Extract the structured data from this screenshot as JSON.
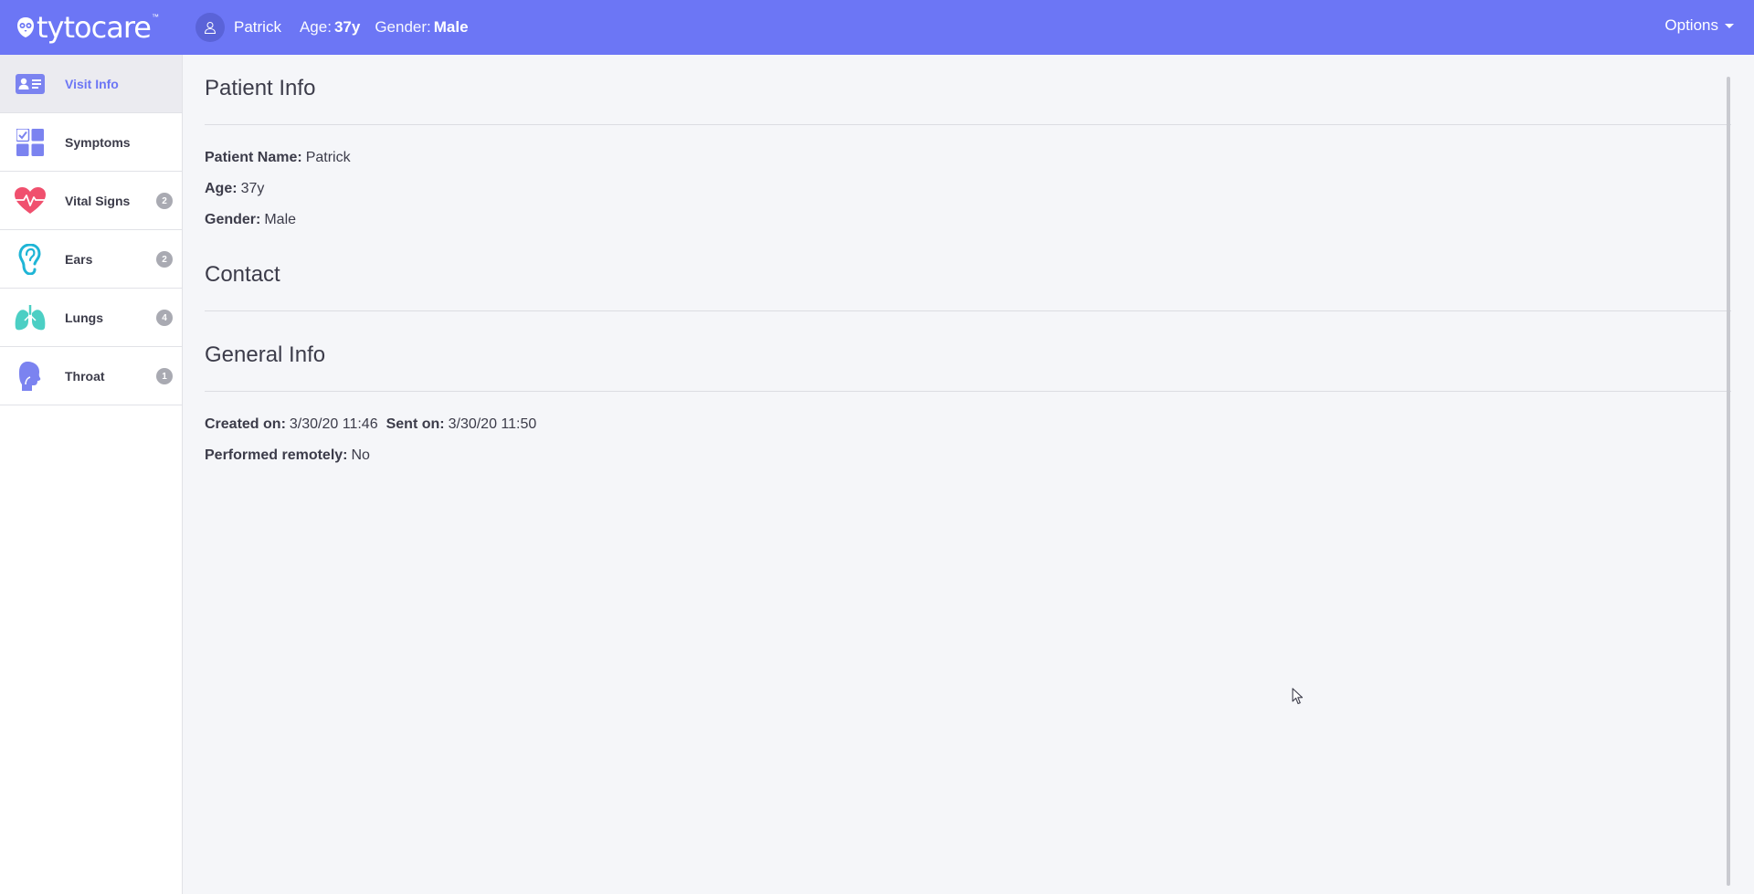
{
  "brand": {
    "logo_text": "tytocare",
    "trademark": "™"
  },
  "header": {
    "patient_name": "Patrick",
    "age_label": "Age:",
    "age_value": "37y",
    "gender_label": "Gender:",
    "gender_value": "Male",
    "options_label": "Options"
  },
  "sidebar": {
    "items": [
      {
        "label": "Visit Info",
        "icon": "id-card-icon",
        "badge": "",
        "active": true
      },
      {
        "label": "Symptoms",
        "icon": "symptoms-grid-icon",
        "badge": "",
        "active": false
      },
      {
        "label": "Vital Signs",
        "icon": "heart-pulse-icon",
        "badge": "2",
        "active": false
      },
      {
        "label": "Ears",
        "icon": "ear-icon",
        "badge": "2",
        "active": false
      },
      {
        "label": "Lungs",
        "icon": "lungs-icon",
        "badge": "4",
        "active": false
      },
      {
        "label": "Throat",
        "icon": "throat-icon",
        "badge": "1",
        "active": false
      }
    ]
  },
  "main": {
    "patient_info": {
      "title": "Patient Info",
      "name_label": "Patient Name:",
      "name_value": "Patrick",
      "age_label": "Age:",
      "age_value": "37y",
      "gender_label": "Gender:",
      "gender_value": "Male"
    },
    "contact": {
      "title": "Contact"
    },
    "general_info": {
      "title": "General Info",
      "created_label": "Created on:",
      "created_value": "3/30/20 11:46",
      "sent_label": "Sent on:",
      "sent_value": "3/30/20 11:50",
      "remote_label": "Performed remotely:",
      "remote_value": "No"
    }
  },
  "colors": {
    "header_bg": "#6c76f5",
    "accent": "#6c76f5",
    "heart": "#f0506e",
    "ear": "#1fb5d6",
    "lungs": "#4ccfc4",
    "throat": "#7b83f0",
    "badge": "#a9aab2"
  }
}
